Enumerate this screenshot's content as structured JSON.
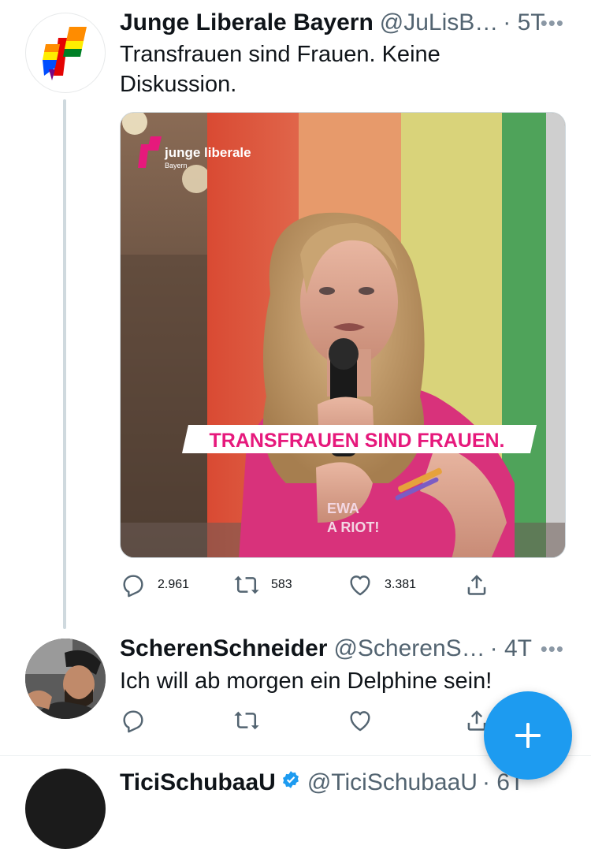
{
  "tweet1": {
    "author_name": "Junge Liberale Bayern",
    "handle": "@JuLisB…",
    "time": "· 5T",
    "text_line1": "Transfrauen sind Frauen. Keine",
    "text_line2": "Diskussion.",
    "media": {
      "brand_name": "junge liberale",
      "brand_sub": "Bayern",
      "banner_text": "TRANSFRAUEN SIND FRAUEN.",
      "shirt_text_1": "EWA",
      "shirt_text_2": "A RIOT!"
    },
    "replies": "2.961",
    "retweets": "583",
    "likes": "3.381"
  },
  "tweet2": {
    "author_name": "ScherenSchneider",
    "handle": "@ScherenS…",
    "time": "· 4T",
    "text": "Ich will ab morgen ein Delphine sein!"
  },
  "tweet3": {
    "author_name": "TiciSchubaaU",
    "handle": "@TiciSchubaaU",
    "time": "· 6T"
  },
  "more_icon": "•••",
  "icons": {
    "reply": "reply-icon",
    "retweet": "retweet-icon",
    "like": "heart-icon",
    "share": "share-icon",
    "compose": "plus-icon"
  },
  "colors": {
    "accent": "#1d9bf0",
    "text": "#0f1419",
    "secondary": "#536471",
    "banner_text": "#e6197c"
  }
}
